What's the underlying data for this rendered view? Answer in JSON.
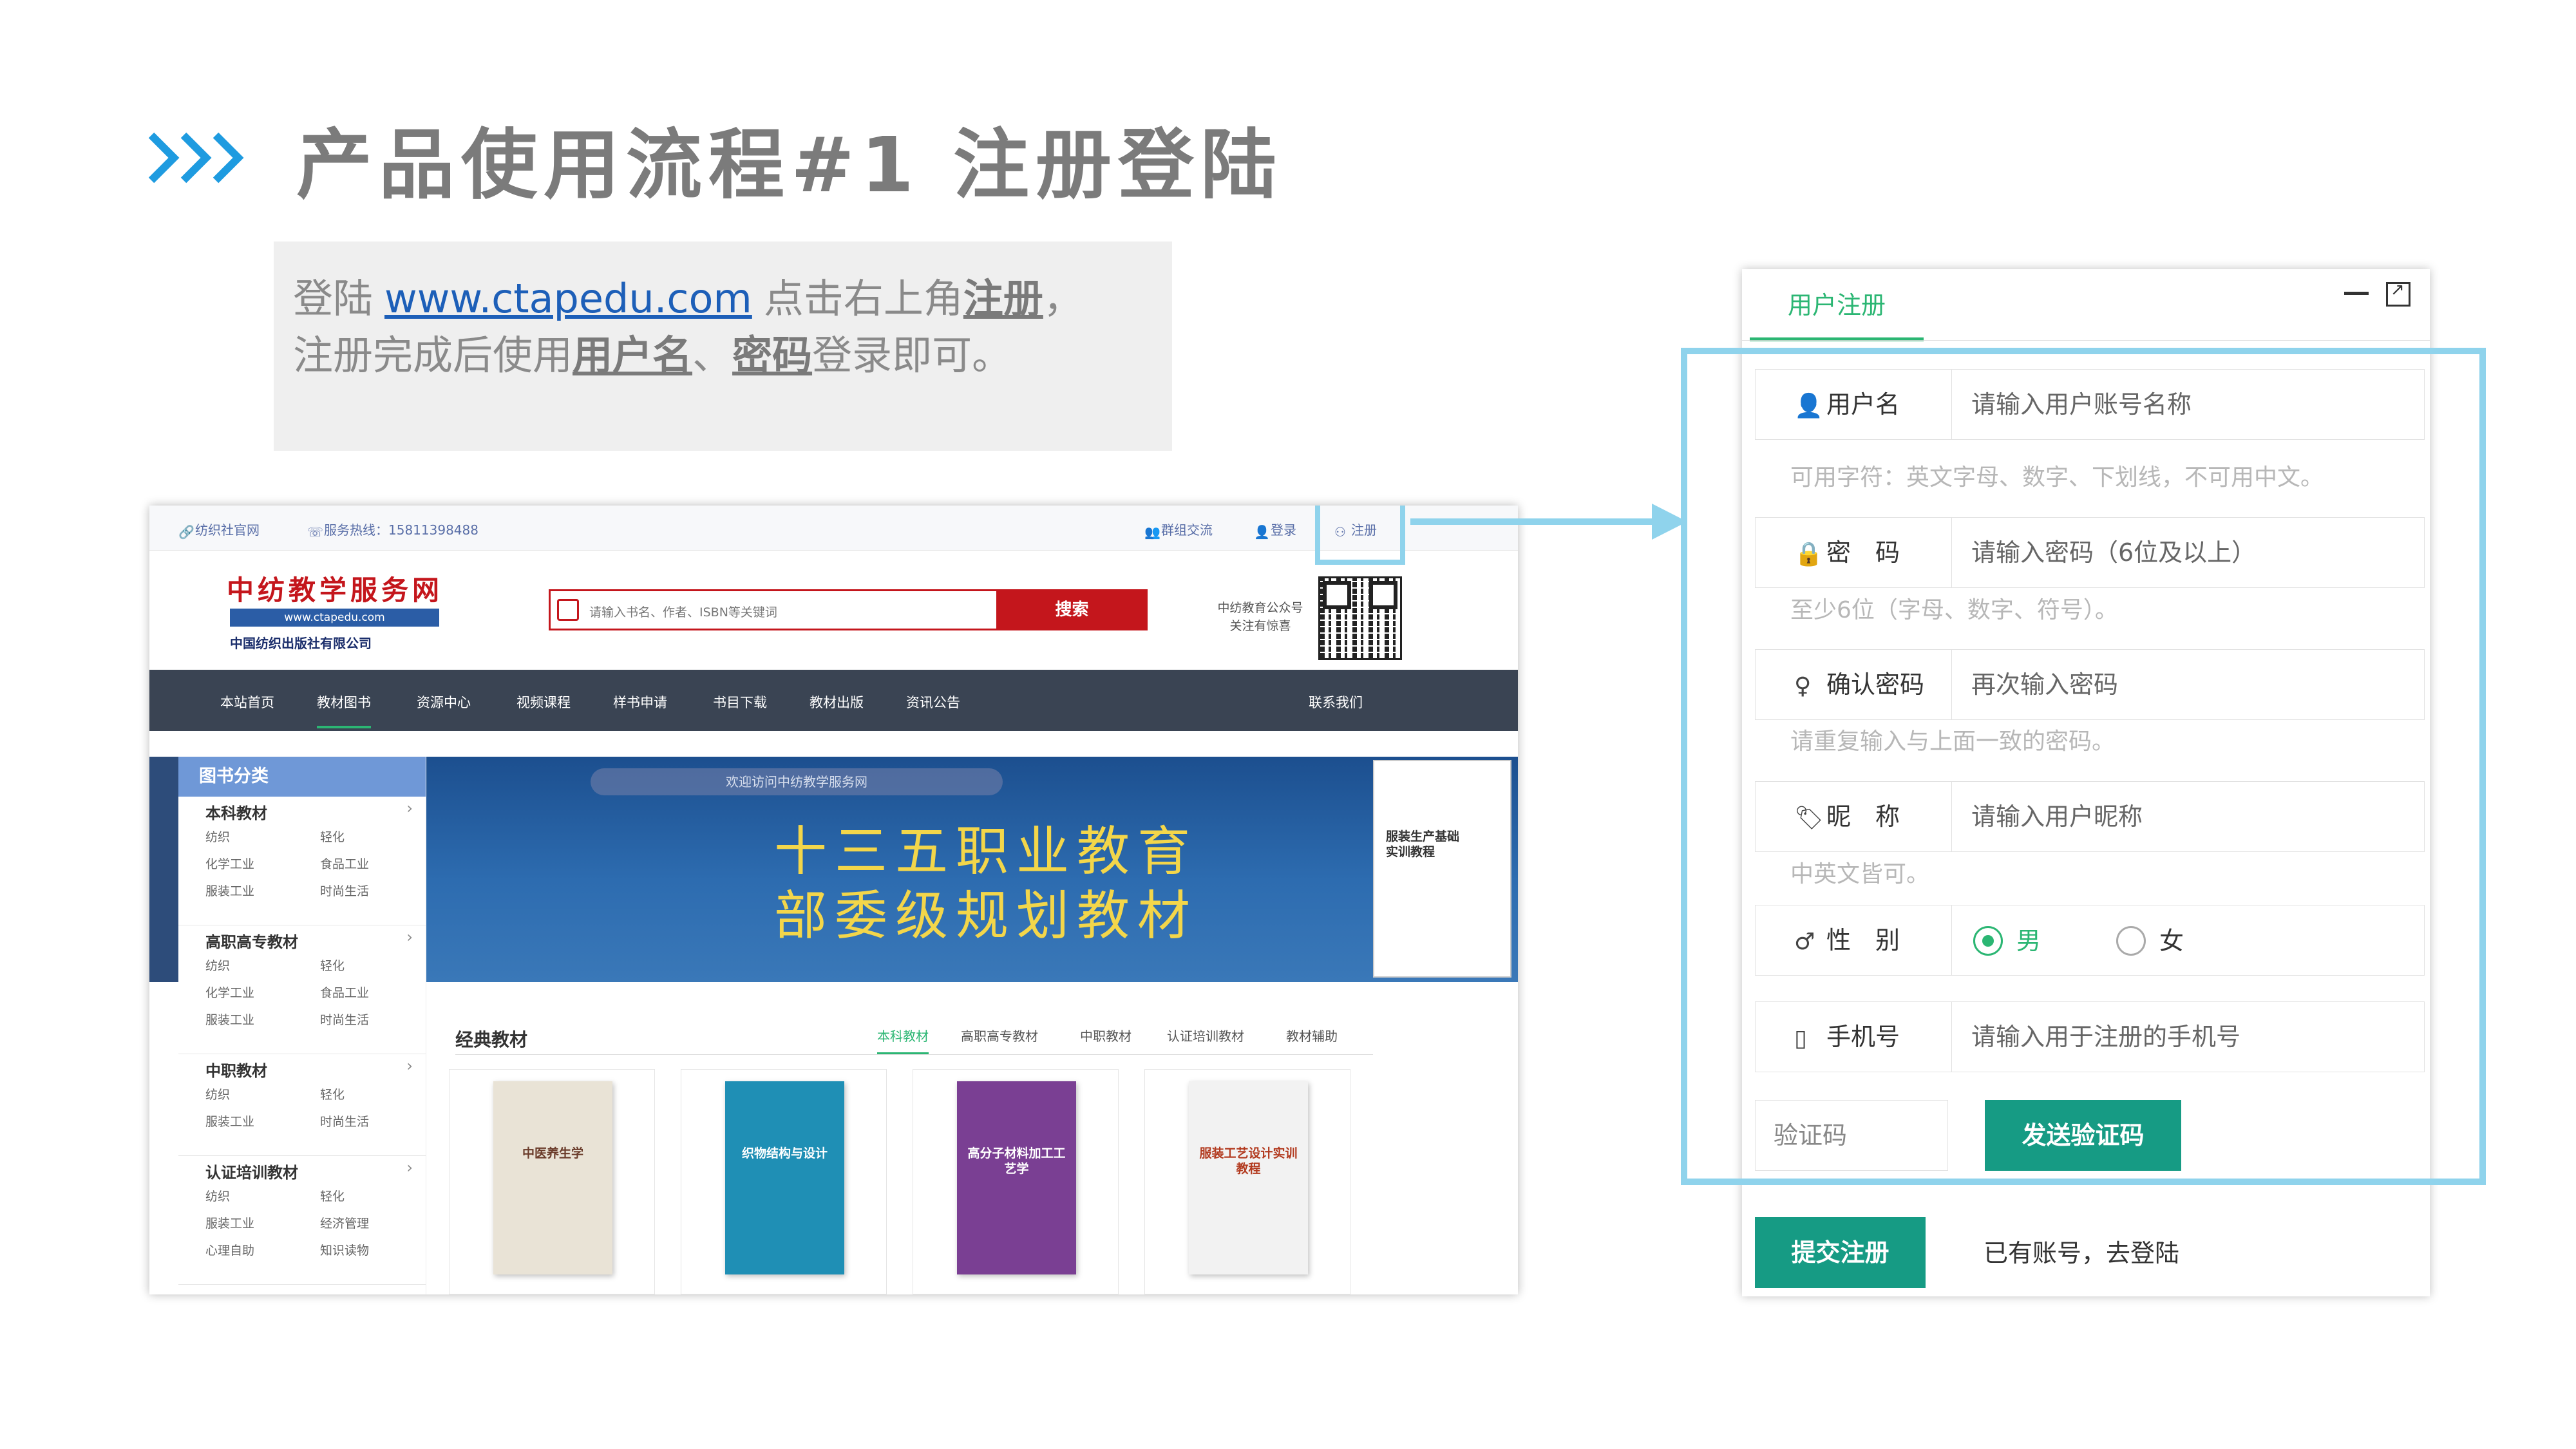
{
  "slide": {
    "title": "产品使用流程#1  注册登陆",
    "instr_prefix": "登陆",
    "instr_link": "www.ctapedu.com",
    "instr_mid": "点击右上角",
    "instr_reg": "注册",
    "instr_tail": "，",
    "instr2_prefix": "注册完成后使用",
    "instr2_user": "用户名",
    "instr2_sep": "、",
    "instr2_pass": "密码",
    "instr2_tail": "登录即可。"
  },
  "site": {
    "topbar": {
      "home_link": "纺织社官网",
      "hotline": "服务热线：15811398488",
      "group": "群组交流",
      "login": "登录",
      "register": "注册"
    },
    "logo": {
      "name": "中纺教学服务网",
      "url": "www.ctapedu.com",
      "publisher": "中国纺织出版社有限公司"
    },
    "search": {
      "placeholder": "请输入书名、作者、ISBN等关键词",
      "button": "搜索"
    },
    "wechat": {
      "label1": "中纺教育公众号",
      "label2": "关注有惊喜"
    },
    "nav": [
      "本站首页",
      "教材图书",
      "资源中心",
      "视频课程",
      "样书申请",
      "书目下载",
      "教材出版",
      "资讯公告",
      "联系我们"
    ],
    "sidebar": {
      "title": "图书分类",
      "categories": [
        {
          "title": "本科教材",
          "subs": [
            "纺织",
            "轻化",
            "化学工业",
            "食品工业",
            "服装工业",
            "时尚生活"
          ]
        },
        {
          "title": "高职高专教材",
          "subs": [
            "纺织",
            "轻化",
            "化学工业",
            "食品工业",
            "服装工业",
            "时尚生活"
          ]
        },
        {
          "title": "中职教材",
          "subs": [
            "纺织",
            "轻化",
            "服装工业",
            "时尚生活"
          ]
        },
        {
          "title": "认证培训教材",
          "subs": [
            "纺织",
            "轻化",
            "服装工业",
            "经济管理",
            "心理自助",
            "知识读物"
          ]
        }
      ]
    },
    "banner": {
      "pill": "欢迎访问中纺教学服务网",
      "line1": "十三五职业教育",
      "line2": "部委级规划教材",
      "book_title": "服装生产基础实训教程"
    },
    "classics": {
      "title": "经典教材",
      "tabs": [
        "本科教材",
        "高职高专教材",
        "中职教材",
        "认证培训教材",
        "教材辅助"
      ],
      "books": [
        {
          "title": "中医养生学",
          "color": "#e9e3d6",
          "text": "#6a3b2a"
        },
        {
          "title": "织物结构与设计",
          "color": "#1f8fb5",
          "text": "#ffffff"
        },
        {
          "title": "高分子材料加工工艺学",
          "color": "#7a3f93",
          "text": "#ffffff"
        },
        {
          "title": "服装工艺设计实训教程",
          "color": "#f2f2f2",
          "text": "#b23a1f"
        }
      ]
    }
  },
  "register": {
    "tab": "用户注册",
    "fields": [
      {
        "label": "用户名",
        "icon": "user-icon",
        "placeholder": "请输入用户账号名称",
        "hint": "可用字符：英文字母、数字、下划线，不可用中文。"
      },
      {
        "label": "密　码",
        "icon": "lock-icon",
        "placeholder": "请输入密码（6位及以上）",
        "hint": "至少6位（字母、数字、符号）。"
      },
      {
        "label": "确认密码",
        "icon": "key-icon",
        "placeholder": "再次输入密码",
        "hint": "请重复输入与上面一致的密码。"
      },
      {
        "label": "昵　称",
        "icon": "tag-icon",
        "placeholder": "请输入用户昵称",
        "hint": "中英文皆可。"
      }
    ],
    "gender": {
      "label": "性　别",
      "icon": "male-icon",
      "male": "男",
      "female": "女",
      "selected": "男"
    },
    "phone": {
      "label": "手机号",
      "icon": "phone-icon",
      "placeholder": "请输入用于注册的手机号"
    },
    "code_placeholder": "验证码",
    "send_code": "发送验证码",
    "submit": "提交注册",
    "login_link": "已有账号，去登陆",
    "accent": "#2bb673",
    "button_color": "#169b84"
  }
}
